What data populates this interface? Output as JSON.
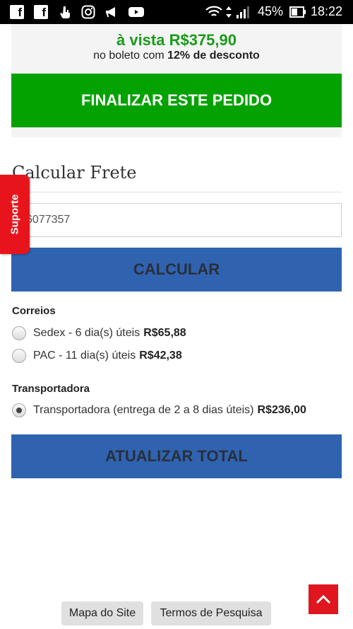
{
  "status_bar": {
    "battery": "45%",
    "time": "18:22"
  },
  "summary": {
    "price_line": "à vista R$375,90",
    "boleto_prefix": "no boleto com",
    "boleto_discount": "12% de desconto",
    "finalize_label": "FINALIZAR ESTE PEDIDO"
  },
  "frete": {
    "title": "Calcular Frete",
    "cep_value": "6077357",
    "calc_label": "CALCULAR",
    "correios_label": "Correios",
    "correios_options": [
      {
        "label": "Sedex - 6 dia(s) úteis",
        "price": "R$65,88",
        "selected": false
      },
      {
        "label": "PAC - 11 dia(s) úteis",
        "price": "R$42,38",
        "selected": false
      }
    ],
    "transportadora_label": "Transportadora",
    "transportadora_options": [
      {
        "label": "Transportadora (entrega de 2 a 8 dias úteis)",
        "price": "R$236,00",
        "selected": true
      }
    ],
    "update_label": "ATUALIZAR TOTAL"
  },
  "support_tab": "Suporte",
  "footer": {
    "sitemap": "Mapa do Site",
    "search_terms": "Termos de Pesquisa"
  },
  "colors": {
    "accent_green": "#04a200",
    "price_green": "#1a9b1a",
    "button_blue": "#2f63b0",
    "support_red": "#e8141c"
  }
}
